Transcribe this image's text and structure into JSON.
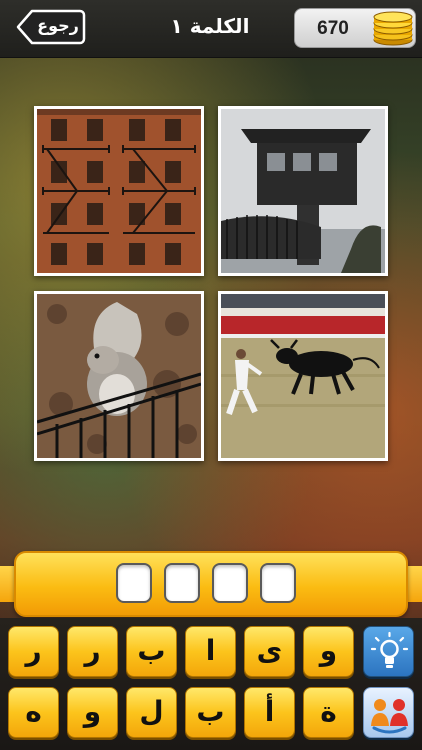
{
  "header": {
    "back_label": "رجوع",
    "title": "الكلمة ١",
    "coins": "670"
  },
  "puzzle": {
    "images": [
      {
        "icon": "building-fire-escape-image"
      },
      {
        "icon": "watch-tower-image"
      },
      {
        "icon": "squirrel-on-fence-image"
      },
      {
        "icon": "man-running-from-bull-image"
      }
    ],
    "answer_slots": [
      "",
      "",
      "",
      ""
    ]
  },
  "keyboard": {
    "row1": [
      "ر",
      "ر",
      "ب",
      "ا",
      "ى",
      "و"
    ],
    "row2": [
      "ه",
      "و",
      "ل",
      "ب",
      "أ",
      "ة"
    ],
    "hint_icon": "lightbulb-icon",
    "share_icon": "friends-help-icon"
  },
  "colors": {
    "key_yellow": "#fcc41c",
    "hint_blue": "#2c74c0",
    "topbar": "#1f1f1c"
  }
}
